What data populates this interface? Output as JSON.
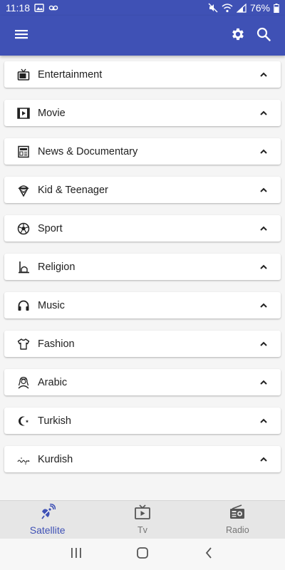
{
  "status": {
    "time": "11:18",
    "battery": "76%"
  },
  "app_bar": {
    "menu_icon": "menu-icon",
    "settings_icon": "gear-icon",
    "search_icon": "search-icon",
    "color": "#3f51b5"
  },
  "categories": [
    {
      "label": "Entertainment",
      "icon": "tv-icon"
    },
    {
      "label": "Movie",
      "icon": "film-icon"
    },
    {
      "label": "News & Documentary",
      "icon": "newspaper-icon"
    },
    {
      "label": "Kid & Teenager",
      "icon": "ice-cream-icon"
    },
    {
      "label": "Sport",
      "icon": "soccer-ball-icon"
    },
    {
      "label": "Religion",
      "icon": "mosque-icon"
    },
    {
      "label": "Music",
      "icon": "headphones-icon"
    },
    {
      "label": "Fashion",
      "icon": "shirt-icon"
    },
    {
      "label": "Arabic",
      "icon": "arab-person-icon"
    },
    {
      "label": "Turkish",
      "icon": "crescent-star-icon"
    },
    {
      "label": "Kurdish",
      "icon": "kurdish-script-icon"
    }
  ],
  "bottom_nav": {
    "items": [
      {
        "label": "Satellite",
        "icon": "satellite-dish-icon",
        "active": true
      },
      {
        "label": "Tv",
        "icon": "tv-play-icon",
        "active": false
      },
      {
        "label": "Radio",
        "icon": "radio-icon",
        "active": false
      }
    ],
    "active_color": "#3f51b5"
  }
}
